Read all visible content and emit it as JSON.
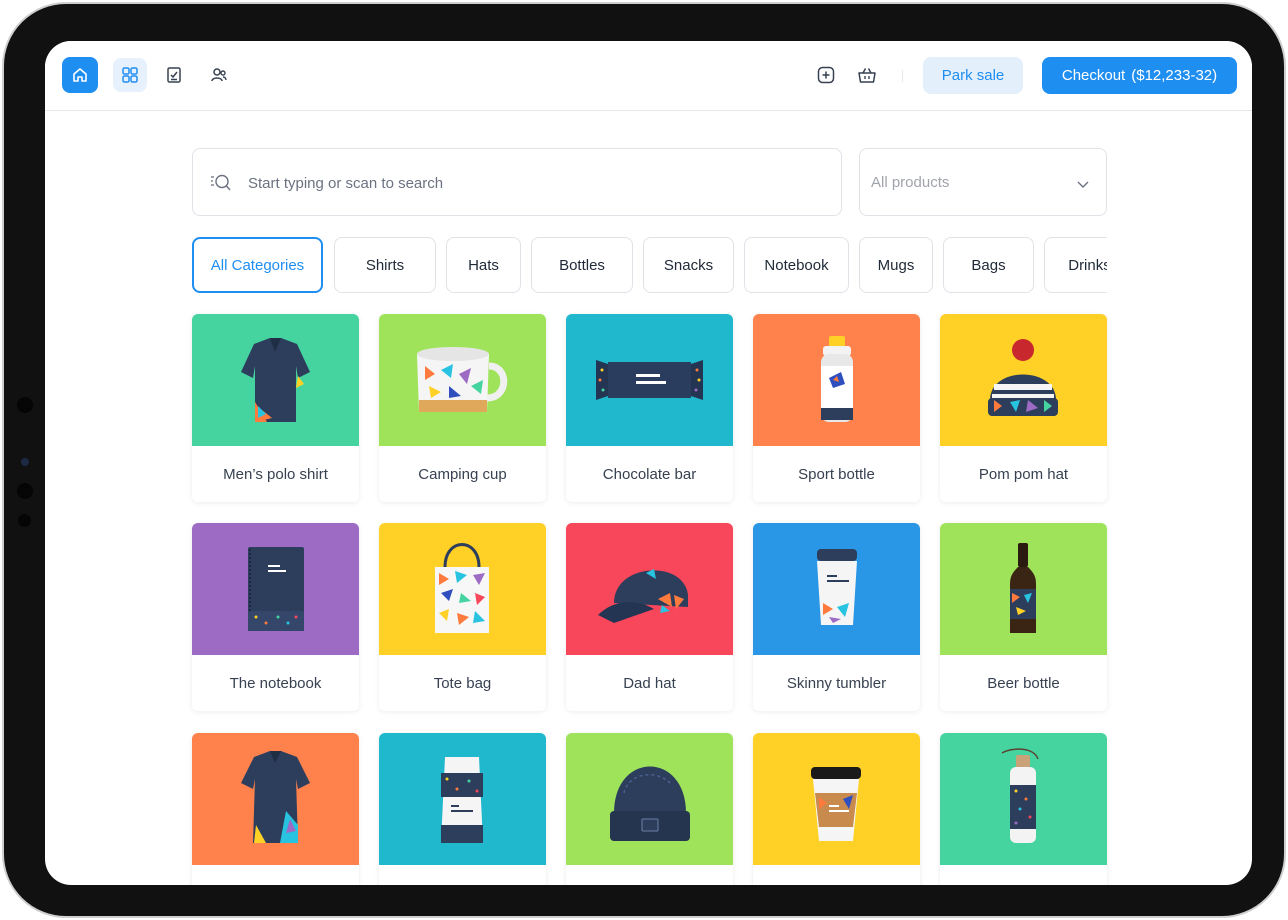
{
  "toolbar": {
    "nav_icons": [
      "home-icon",
      "grid-icon",
      "checklist-icon",
      "users-icon"
    ],
    "tool_icons": [
      "add-item-icon",
      "basket-icon"
    ],
    "park_sale_label": "Park sale",
    "checkout_label": "Checkout",
    "checkout_amount": "($12,233-32)",
    "accent_color": "#1f8ef1"
  },
  "search": {
    "placeholder": "Start typing or scan to search"
  },
  "filter": {
    "selected": "All products"
  },
  "categories": [
    "All Categories",
    "Shirts",
    "Hats",
    "Bottles",
    "Snacks",
    "Notebook",
    "Mugs",
    "Bags",
    "Drinks"
  ],
  "active_category": "All Categories",
  "products": [
    {
      "name": "Men’s polo shirt",
      "color": "#45d3a0",
      "icon": "polo-shirt-icon"
    },
    {
      "name": "Camping cup",
      "color": "#9fe35b",
      "icon": "mug-icon"
    },
    {
      "name": "Chocolate bar",
      "color": "#1fb8cd",
      "icon": "chocolate-bar-icon"
    },
    {
      "name": "Sport bottle",
      "color": "#ff824d",
      "icon": "sport-bottle-icon"
    },
    {
      "name": "Pom pom hat",
      "color": "#ffd025",
      "icon": "beanie-icon"
    },
    {
      "name": "The notebook",
      "color": "#9d6ac4",
      "icon": "notebook-icon"
    },
    {
      "name": "Tote bag",
      "color": "#ffd025",
      "icon": "tote-bag-icon"
    },
    {
      "name": "Dad hat",
      "color": "#f8465b",
      "icon": "cap-icon"
    },
    {
      "name": "Skinny tumbler",
      "color": "#2a96e6",
      "icon": "tumbler-icon"
    },
    {
      "name": "Beer bottle",
      "color": "#9fe35b",
      "icon": "beer-bottle-icon"
    },
    {
      "name": "",
      "color": "#ff824d",
      "icon": "womens-polo-icon"
    },
    {
      "name": "",
      "color": "#1fb8cd",
      "icon": "coffee-bag-icon"
    },
    {
      "name": "",
      "color": "#9fe35b",
      "icon": "knit-hat-icon"
    },
    {
      "name": "",
      "color": "#ffd025",
      "icon": "coffee-cup-icon"
    },
    {
      "name": "",
      "color": "#45d3a0",
      "icon": "water-bottle-icon"
    }
  ]
}
